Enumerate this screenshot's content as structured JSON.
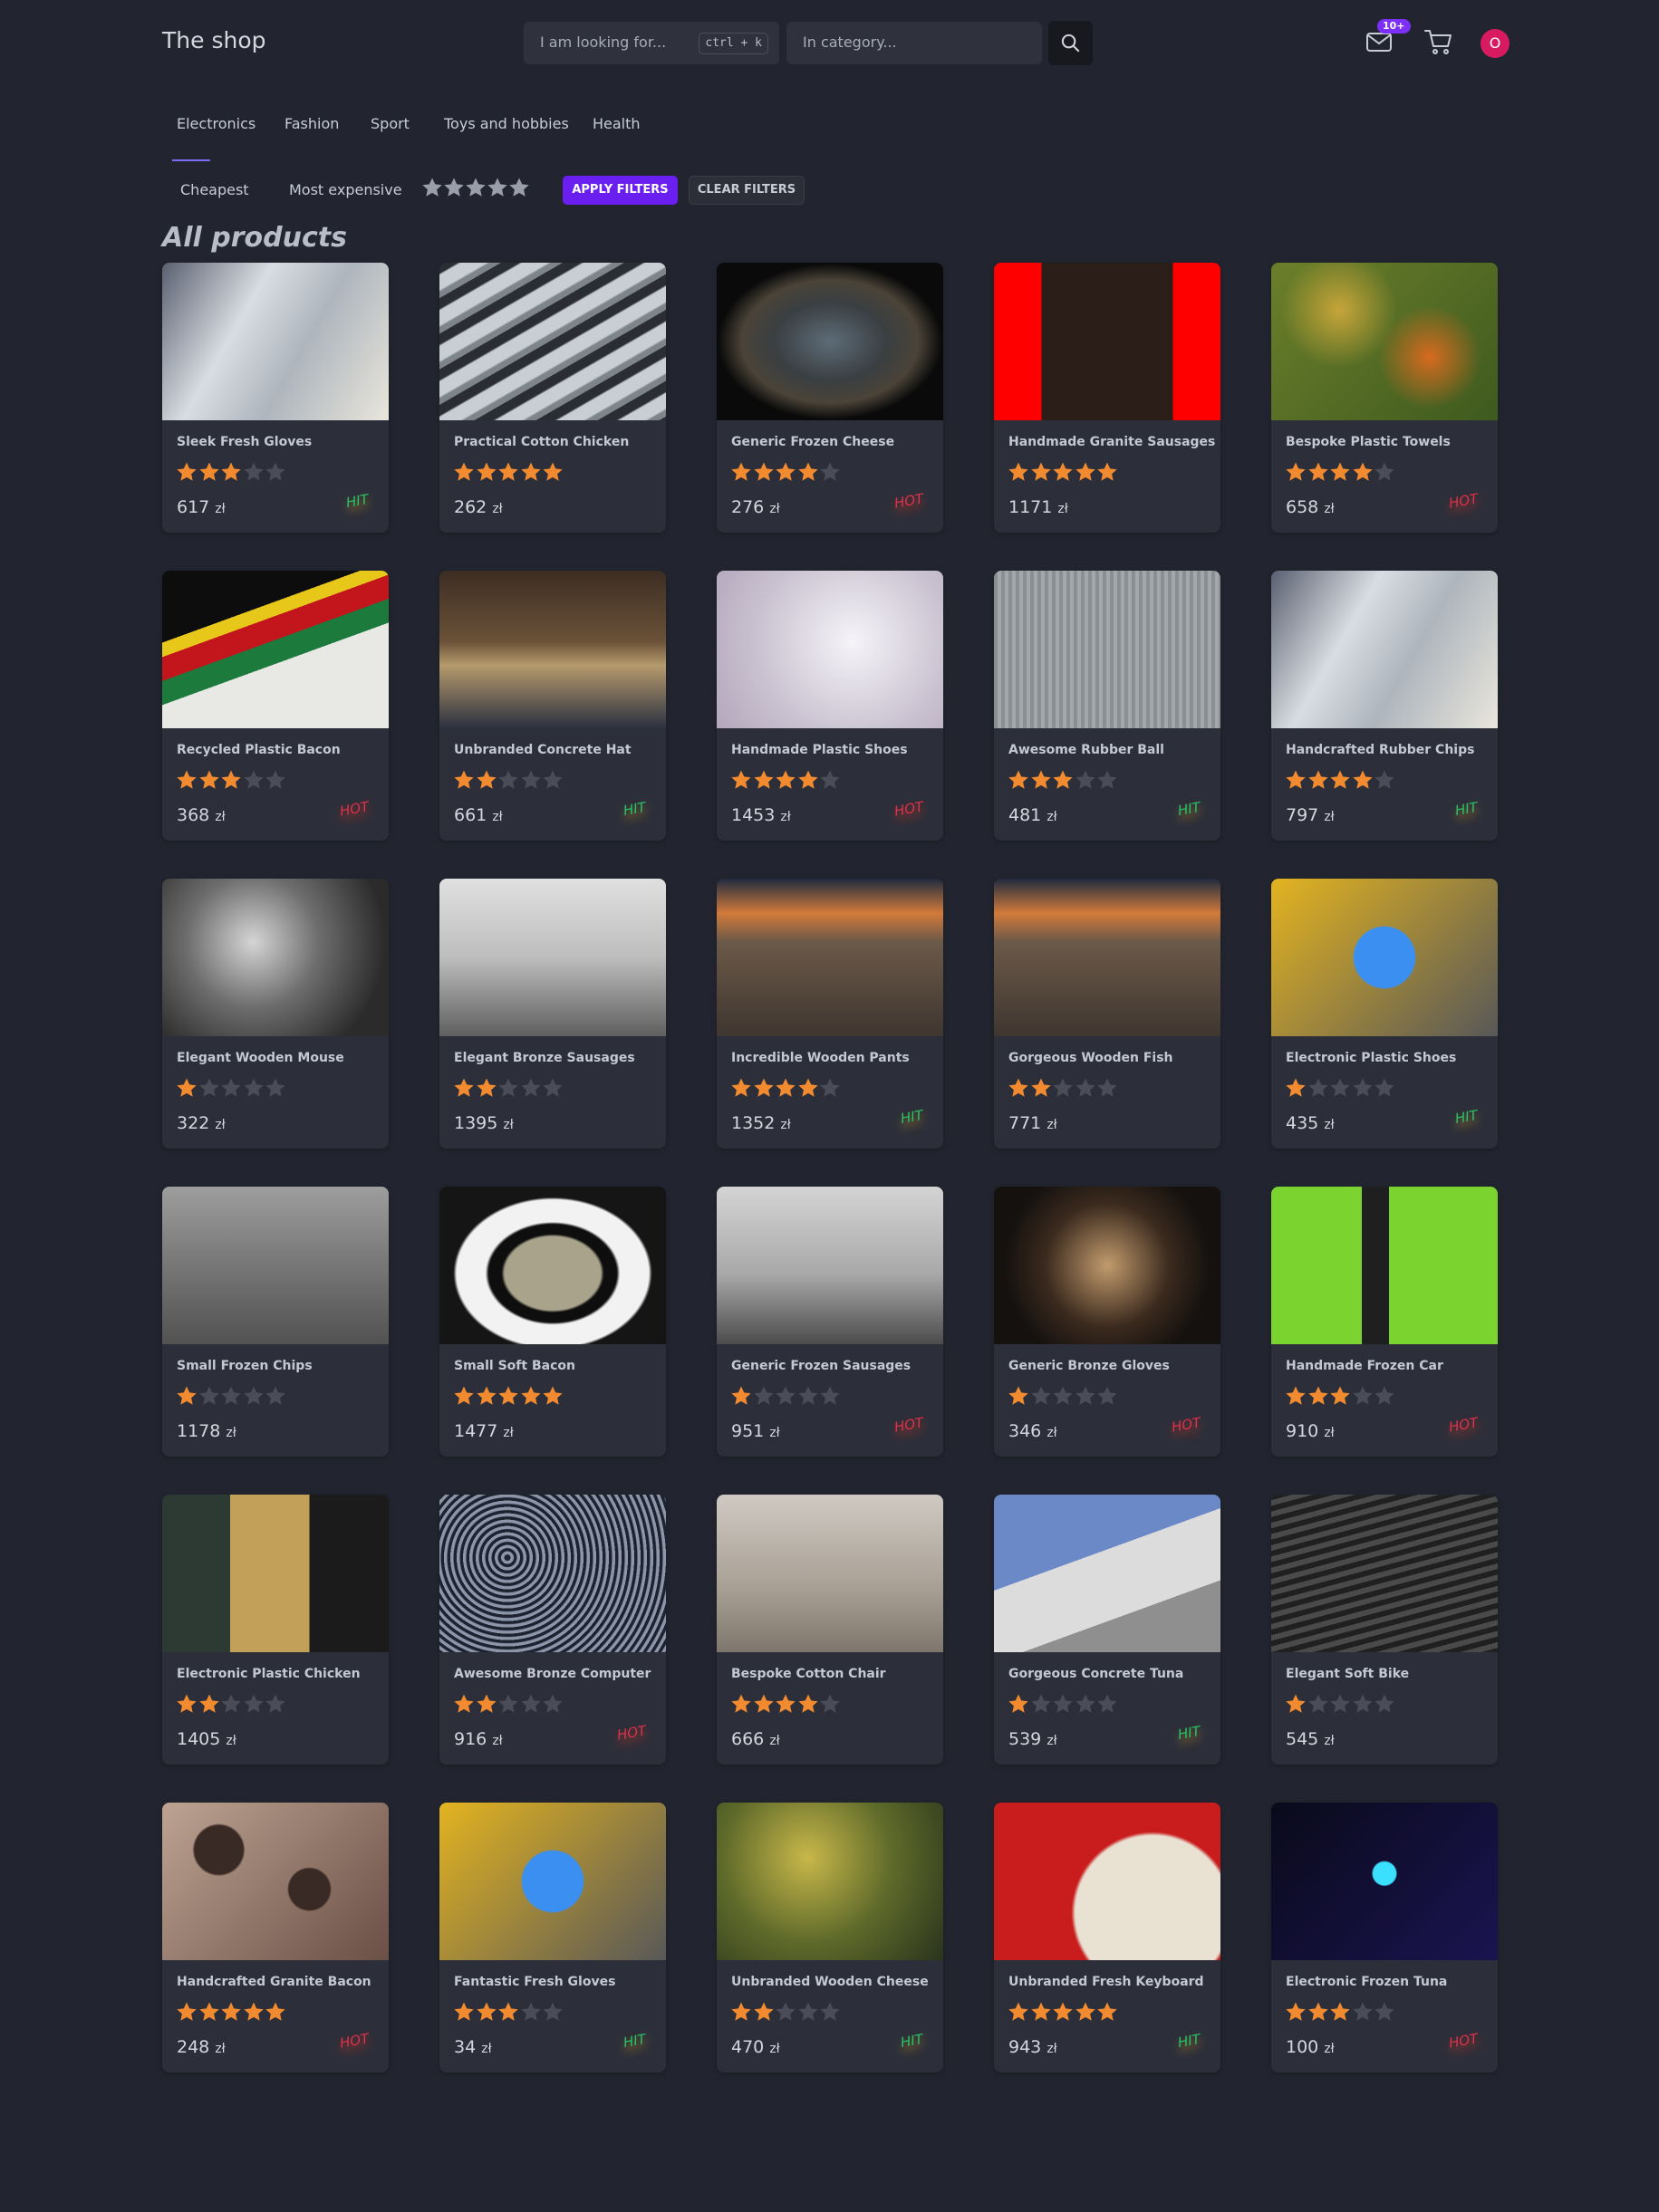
{
  "header": {
    "brand": "The shop",
    "search_placeholder": "I am looking for...",
    "shortcut": "ctrl + k",
    "category_placeholder": "In category...",
    "mail_badge": "10+",
    "avatar_initial": "O"
  },
  "tabs": [
    "Electronics",
    "Fashion",
    "Sport",
    "Toys and hobbies",
    "Health"
  ],
  "active_tab": "Electronics",
  "filters": {
    "cheapest": "Cheapest",
    "most_expensive": "Most expensive",
    "apply": "APPLY FILTERS",
    "clear": "CLEAR FILTERS"
  },
  "heading": "All products",
  "currency": "zł",
  "colors": {
    "accent": "#6a1ff0",
    "star_on": "#f28b30",
    "star_off": "#4a4d57",
    "hot": "#e0304a",
    "hit": "#28c464",
    "avatar": "#d81b60"
  },
  "products": [
    {
      "name": "Sleek Fresh Gloves",
      "rating": 3,
      "price": "617",
      "tag": "HIT"
    },
    {
      "name": "Practical Cotton Chicken",
      "rating": 5,
      "price": "262",
      "tag": ""
    },
    {
      "name": "Generic Frozen Cheese",
      "rating": 4,
      "price": "276",
      "tag": "HOT"
    },
    {
      "name": "Handmade Granite Sausages",
      "rating": 5,
      "price": "1171",
      "tag": ""
    },
    {
      "name": "Bespoke Plastic Towels",
      "rating": 4,
      "price": "658",
      "tag": "HOT"
    },
    {
      "name": "Recycled Plastic Bacon",
      "rating": 3,
      "price": "368",
      "tag": "HOT"
    },
    {
      "name": "Unbranded Concrete Hat",
      "rating": 2,
      "price": "661",
      "tag": "HIT"
    },
    {
      "name": "Handmade Plastic Shoes",
      "rating": 4,
      "price": "1453",
      "tag": "HOT"
    },
    {
      "name": "Awesome Rubber Ball",
      "rating": 3,
      "price": "481",
      "tag": "HIT"
    },
    {
      "name": "Handcrafted Rubber Chips",
      "rating": 4,
      "price": "797",
      "tag": "HIT"
    },
    {
      "name": "Elegant Wooden Mouse",
      "rating": 1,
      "price": "322",
      "tag": ""
    },
    {
      "name": "Elegant Bronze Sausages",
      "rating": 2,
      "price": "1395",
      "tag": ""
    },
    {
      "name": "Incredible Wooden Pants",
      "rating": 4,
      "price": "1352",
      "tag": "HIT"
    },
    {
      "name": "Gorgeous Wooden Fish",
      "rating": 2,
      "price": "771",
      "tag": ""
    },
    {
      "name": "Electronic Plastic Shoes",
      "rating": 1,
      "price": "435",
      "tag": "HIT"
    },
    {
      "name": "Small Frozen Chips",
      "rating": 1,
      "price": "1178",
      "tag": ""
    },
    {
      "name": "Small Soft Bacon",
      "rating": 5,
      "price": "1477",
      "tag": ""
    },
    {
      "name": "Generic Frozen Sausages",
      "rating": 1,
      "price": "951",
      "tag": "HOT"
    },
    {
      "name": "Generic Bronze Gloves",
      "rating": 1,
      "price": "346",
      "tag": "HOT"
    },
    {
      "name": "Handmade Frozen Car",
      "rating": 3,
      "price": "910",
      "tag": "HOT"
    },
    {
      "name": "Electronic Plastic Chicken",
      "rating": 2,
      "price": "1405",
      "tag": ""
    },
    {
      "name": "Awesome Bronze Computer",
      "rating": 2,
      "price": "916",
      "tag": "HOT"
    },
    {
      "name": "Bespoke Cotton Chair",
      "rating": 4,
      "price": "666",
      "tag": ""
    },
    {
      "name": "Gorgeous Concrete Tuna",
      "rating": 1,
      "price": "539",
      "tag": "HIT"
    },
    {
      "name": "Elegant Soft Bike",
      "rating": 1,
      "price": "545",
      "tag": ""
    },
    {
      "name": "Handcrafted Granite Bacon",
      "rating": 5,
      "price": "248",
      "tag": "HOT"
    },
    {
      "name": "Fantastic Fresh Gloves",
      "rating": 3,
      "price": "34",
      "tag": "HIT"
    },
    {
      "name": "Unbranded Wooden Cheese",
      "rating": 2,
      "price": "470",
      "tag": "HIT"
    },
    {
      "name": "Unbranded Fresh Keyboard",
      "rating": 5,
      "price": "943",
      "tag": "HIT"
    },
    {
      "name": "Electronic Frozen Tuna",
      "rating": 3,
      "price": "100",
      "tag": "HOT"
    }
  ]
}
